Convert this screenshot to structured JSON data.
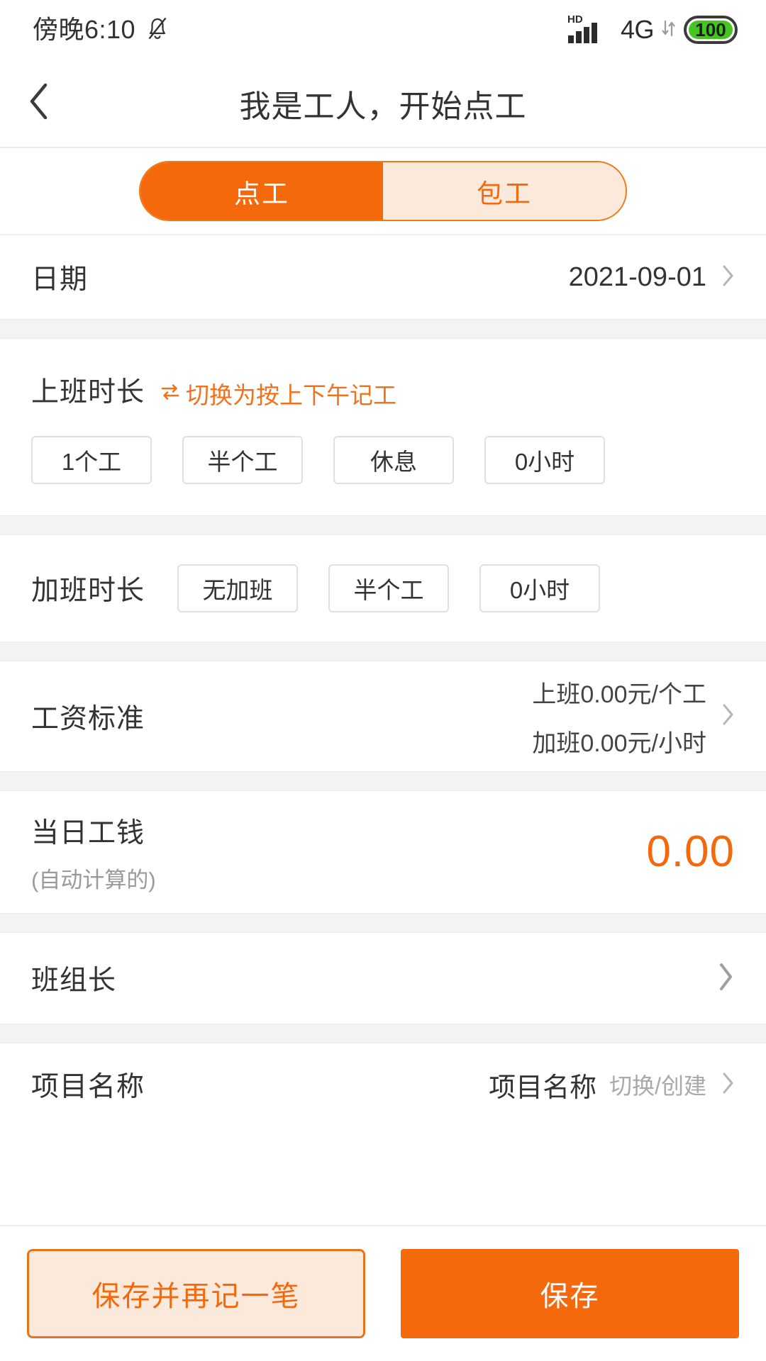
{
  "statusbar": {
    "time": "傍晚6:10",
    "bell_icon": "bell-mute-icon",
    "hd_label": "HD",
    "network": "4G",
    "battery_level": "100"
  },
  "header": {
    "back_icon": "chevron-left-icon",
    "title": "我是工人，开始点工"
  },
  "segmented": {
    "active_index": 0,
    "options": [
      {
        "label": "点工"
      },
      {
        "label": "包工"
      }
    ]
  },
  "date_row": {
    "label": "日期",
    "value": "2021-09-01",
    "chevron": "chevron-right-icon"
  },
  "work_hours": {
    "title": "上班时长",
    "switch_link": "切换为按上下午记工",
    "switch_icon": "swap-arrows-icon",
    "options": [
      {
        "label": "1个工"
      },
      {
        "label": "半个工"
      },
      {
        "label": "休息"
      },
      {
        "label": "0小时"
      }
    ]
  },
  "overtime": {
    "title": "加班时长",
    "options": [
      {
        "label": "无加班"
      },
      {
        "label": "半个工"
      },
      {
        "label": "0小时"
      }
    ]
  },
  "wage_standard": {
    "label": "工资标准",
    "line1": "上班0.00元/个工",
    "line2": "加班0.00元/小时",
    "chevron": "chevron-right-icon"
  },
  "daily_wage": {
    "label": "当日工钱",
    "sublabel": "(自动计算的)",
    "amount": "0.00"
  },
  "foreman": {
    "label": "班组长",
    "chevron": "chevron-right-icon"
  },
  "project": {
    "label": "项目名称",
    "value": "项目名称",
    "hint": "切换/创建",
    "chevron": "chevron-right-icon"
  },
  "actions": {
    "secondary_label": "保存并再记一笔",
    "primary_label": "保存"
  },
  "colors": {
    "accent": "#f4690b",
    "accent_light": "#fbe9dc",
    "text": "#333333",
    "muted": "#9a9a9a",
    "divider": "#f3f3f3",
    "battery_green": "#44c523"
  }
}
